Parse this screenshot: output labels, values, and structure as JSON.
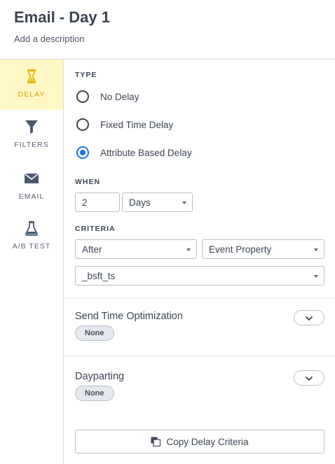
{
  "header": {
    "title": "Email - Day 1",
    "description_placeholder": "Add a description"
  },
  "sidebar": {
    "items": [
      {
        "label": "DELAY",
        "icon": "hourglass-icon",
        "active": true
      },
      {
        "label": "FILTERS",
        "icon": "funnel-icon",
        "active": false
      },
      {
        "label": "EMAIL",
        "icon": "envelope-icon",
        "active": false
      },
      {
        "label": "A/B TEST",
        "icon": "flask-icon",
        "active": false
      }
    ]
  },
  "type": {
    "label": "TYPE",
    "options": [
      {
        "label": "No Delay",
        "checked": false
      },
      {
        "label": "Fixed Time Delay",
        "checked": false
      },
      {
        "label": "Attribute Based Delay",
        "checked": true
      }
    ]
  },
  "when": {
    "label": "WHEN",
    "amount": "2",
    "unit": "Days"
  },
  "criteria": {
    "label": "CRITERIA",
    "relation": "After",
    "source": "Event Property",
    "property": "_bsft_ts"
  },
  "send_time_optimization": {
    "title": "Send Time Optimization",
    "value": "None"
  },
  "dayparting": {
    "title": "Dayparting",
    "value": "None"
  },
  "copy_button": {
    "label": "Copy Delay Criteria"
  },
  "colors": {
    "accent": "#1a73e8",
    "active_bg": "#fff8c4",
    "active_fg": "#d9a400"
  }
}
